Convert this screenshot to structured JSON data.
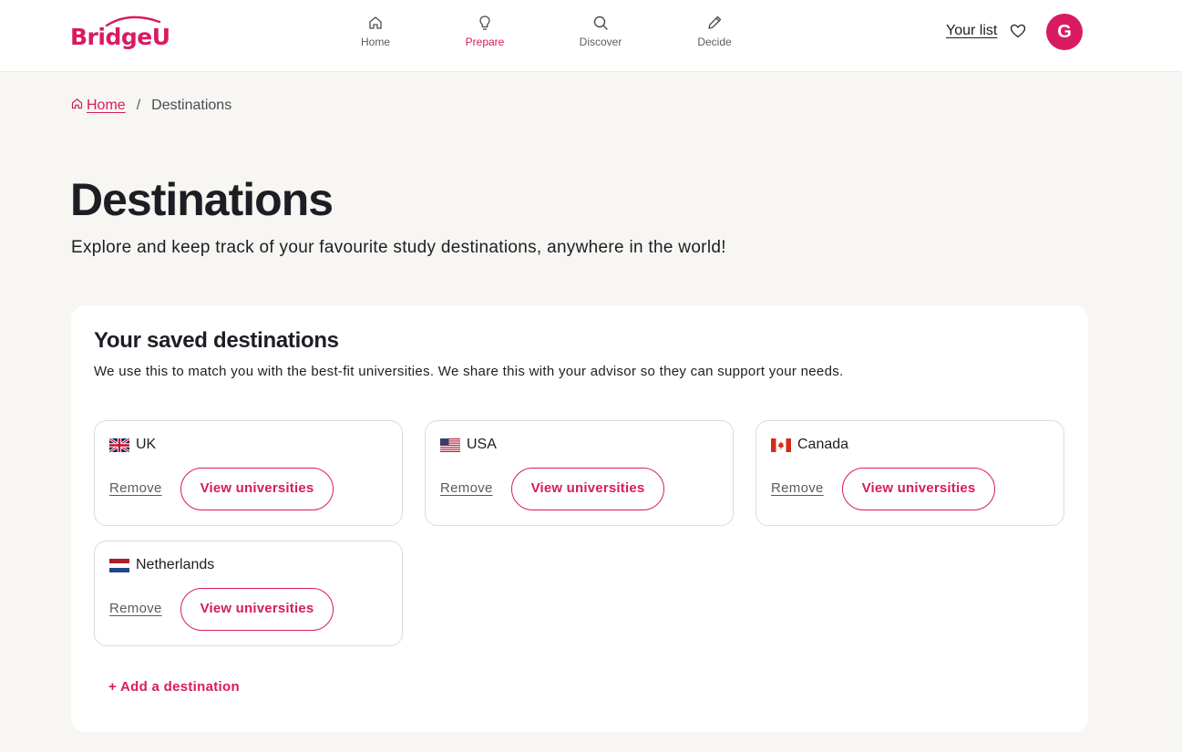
{
  "brand": {
    "logo_text": "BridgeU",
    "accent": "#d81b60"
  },
  "nav": [
    {
      "label": "Home",
      "icon": "home-icon",
      "active": false
    },
    {
      "label": "Prepare",
      "icon": "lightbulb-icon",
      "active": true
    },
    {
      "label": "Discover",
      "icon": "search-icon",
      "active": false
    },
    {
      "label": "Decide",
      "icon": "pencil-icon",
      "active": false
    }
  ],
  "header": {
    "your_list": "Your list",
    "avatar_initial": "G"
  },
  "breadcrumb": {
    "home": "Home",
    "separator": "/",
    "current": "Destinations"
  },
  "page": {
    "title": "Destinations",
    "subtitle": "Explore and keep track of your favourite study destinations, anywhere in the world!"
  },
  "saved": {
    "title": "Your saved destinations",
    "description": "We use this to match you with the best-fit universities. We share this with your advisor so they can support your needs.",
    "destinations": [
      {
        "name": "UK",
        "flag": "uk-flag-icon",
        "remove": "Remove",
        "view": "View universities"
      },
      {
        "name": "USA",
        "flag": "usa-flag-icon",
        "remove": "Remove",
        "view": "View universities"
      },
      {
        "name": "Canada",
        "flag": "canada-flag-icon",
        "remove": "Remove",
        "view": "View universities"
      },
      {
        "name": "Netherlands",
        "flag": "netherlands-flag-icon",
        "remove": "Remove",
        "view": "View universities"
      }
    ],
    "add_label": "+ Add a destination"
  }
}
